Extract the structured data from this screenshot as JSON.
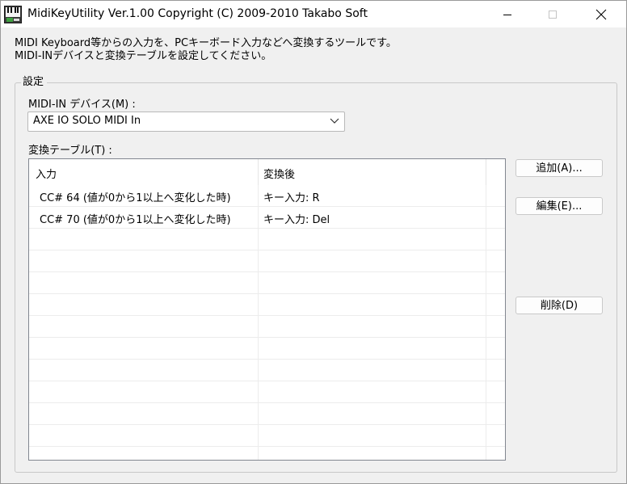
{
  "window": {
    "title": "MidiKeyUtility Ver.1.00 Copyright (C) 2009-2010 Takabo Soft"
  },
  "description": {
    "line1": "MIDI Keyboard等からの入力を、PCキーボード入力などへ変換するツールです。",
    "line2": "MIDI-INデバイスと変換テーブルを設定してください。"
  },
  "settings_group": {
    "legend": "設定",
    "device_label": "MIDI-IN デバイス(M) :",
    "device_selected": "AXE IO SOLO MIDI In",
    "table_label": "変換テーブル(T) :"
  },
  "table": {
    "columns": [
      "入力",
      "変換後"
    ],
    "rows": [
      {
        "input": "CC# 64 (値が0から1以上へ変化した時)",
        "output": "キー入力: R"
      },
      {
        "input": "CC# 70 (値が0から1以上へ変化した時)",
        "output": "キー入力: Del"
      }
    ],
    "empty_rows": 10
  },
  "buttons": {
    "add": "追加(A)...",
    "edit": "編集(E)...",
    "delete": "削除(D)"
  },
  "icons": {
    "app": "piano-keyboard-icon",
    "minimize": "minimize-icon",
    "maximize": "maximize-icon",
    "close": "close-icon",
    "dropdown": "chevron-down-icon"
  }
}
